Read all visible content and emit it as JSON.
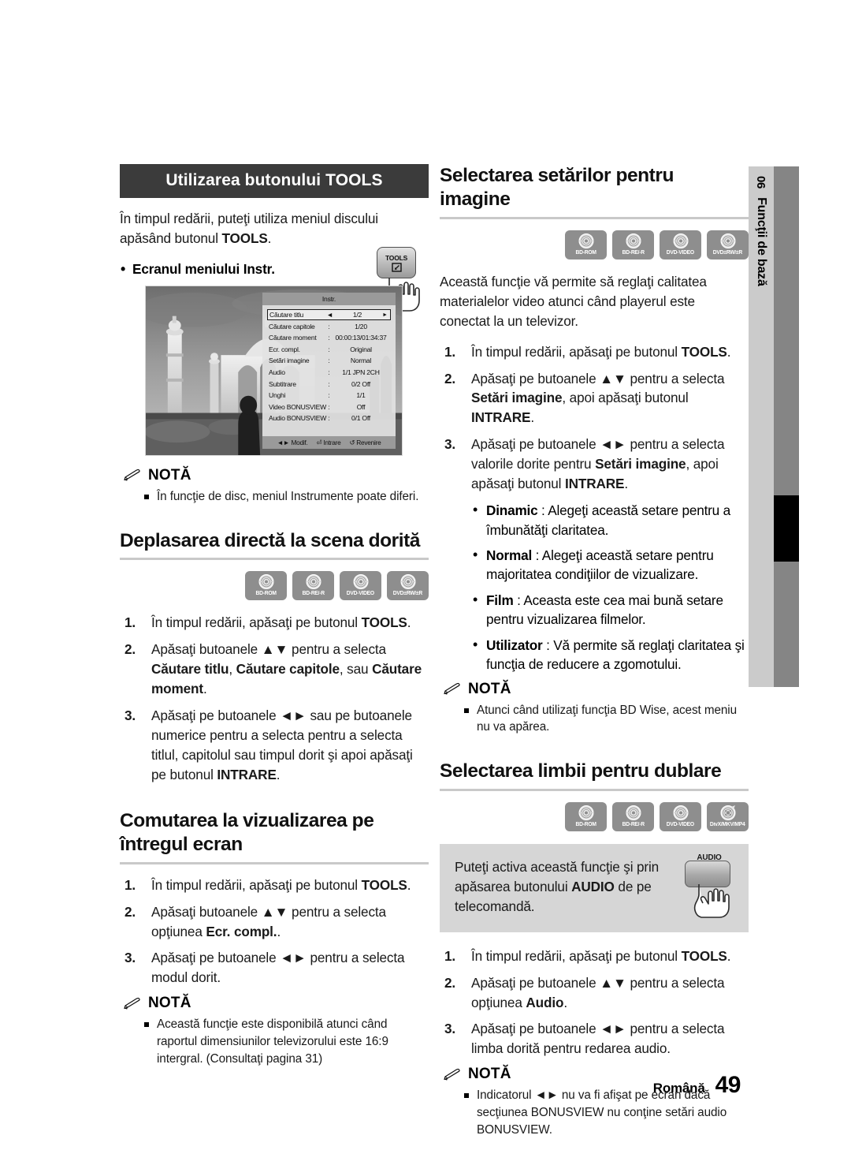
{
  "sidetab": {
    "number": "06",
    "label": "Funcţii de bază"
  },
  "footer": {
    "language": "Română",
    "page": "49"
  },
  "left_column": {
    "tools_header": "Utilizarea butonului TOOLS",
    "intro_before": "În timpul redării, puteţi utiliza meniul discului apăsând butonul ",
    "intro_bold": "TOOLS",
    "intro_after": ".",
    "tools_button_caption": "TOOLS",
    "screen_bullet": "Ecranul meniului Instr.",
    "osd": {
      "title": "Instr.",
      "rows": [
        {
          "key": "Căutare titlu",
          "sep": "",
          "value": "1/2",
          "selected": true
        },
        {
          "key": "Căutare capitole",
          "sep": ":",
          "value": "1/20",
          "selected": false
        },
        {
          "key": "Căutare moment",
          "sep": ":",
          "value": "00:00:13/01:34:37",
          "selected": false
        },
        {
          "key": "Ecr. compl.",
          "sep": ":",
          "value": "Original",
          "selected": false
        },
        {
          "key": "Setări imagine",
          "sep": ":",
          "value": "Normal",
          "selected": false
        },
        {
          "key": "Audio",
          "sep": ":",
          "value": "1/1 JPN 2CH",
          "selected": false
        },
        {
          "key": "Subtitrare",
          "sep": ":",
          "value": "0/2 Off",
          "selected": false
        },
        {
          "key": "Unghi",
          "sep": ":",
          "value": "1/1",
          "selected": false
        },
        {
          "key": "Video BONUSVIEW",
          "sep": ":",
          "value": "Off",
          "selected": false
        },
        {
          "key": "Audio BONUSVIEW",
          "sep": ":",
          "value": "0/1 Off",
          "selected": false
        }
      ],
      "footer": [
        "◄► Modif.",
        "Intrare",
        "Revenire"
      ]
    },
    "nota1": {
      "label": "NOTĂ",
      "items": [
        "În funcţie de disc, meniul Instrumente poate diferi."
      ]
    },
    "section2": {
      "heading": "Deplasarea directă la scena dorită",
      "discs": [
        "BD-ROM",
        "BD-RE/-R",
        "DVD-VIDEO",
        "DVD±RW/±R"
      ],
      "steps": [
        {
          "num": "1.",
          "html": "În timpul redării, apăsaţi pe butonul <b>TOOLS</b>."
        },
        {
          "num": "2.",
          "html": "Apăsaţi butoanele ▲▼ pentru a selecta <b>Căutare titlu</b>, <b>Căutare capitole</b>, sau <b>Căutare moment</b>."
        },
        {
          "num": "3.",
          "html": "Apăsaţi pe butoanele ◄► sau pe butoanele numerice pentru a selecta pentru a selecta titlul, capitolul sau timpul dorit şi apoi apăsaţi pe butonul <b>INTRARE</b>."
        }
      ]
    },
    "section3": {
      "heading": "Comutarea la vizualizarea pe întregul ecran",
      "steps": [
        {
          "num": "1.",
          "html": "În timpul redării, apăsaţi pe butonul <b>TOOLS</b>."
        },
        {
          "num": "2.",
          "html": "Apăsaţi butoanele ▲▼ pentru a selecta opţiunea <b>Ecr. compl.</b>."
        },
        {
          "num": "3.",
          "html": "Apăsaţi pe butoanele ◄► pentru a selecta modul dorit."
        }
      ],
      "nota": {
        "label": "NOTĂ",
        "items": [
          "Această funcţie este disponibilă atunci când raportul dimensiunilor televizorului este 16:9 intergral. (Consultaţi pagina 31)"
        ]
      }
    }
  },
  "right_column": {
    "section1": {
      "heading": "Selectarea setărilor pentru imagine",
      "discs": [
        "BD-ROM",
        "BD-RE/-R",
        "DVD-VIDEO",
        "DVD±RW/±R"
      ],
      "intro": "Această funcţie vă permite să reglaţi calitatea materialelor video atunci când playerul este conectat la un televizor.",
      "steps": [
        {
          "num": "1.",
          "html": "În timpul redării, apăsaţi pe butonul <b>TOOLS</b>."
        },
        {
          "num": "2.",
          "html": "Apăsaţi pe butoanele ▲▼ pentru a selecta <b>Setări imagine</b>, apoi apăsaţi butonul <b>INTRARE</b>."
        },
        {
          "num": "3.",
          "html": "Apăsaţi pe butoanele ◄► pentru a selecta valorile dorite pentru <b>Setări imagine</b>, apoi apăsaţi butonul <b>INTRARE</b>."
        }
      ],
      "options": [
        {
          "name": "Dinamic",
          "desc": " : Alegeţi această setare pentru a îmbunătăţi claritatea."
        },
        {
          "name": "Normal",
          "desc": " : Alegeţi această setare pentru majoritatea condiţiilor de vizualizare."
        },
        {
          "name": "Film",
          "desc": " : Aceasta este cea mai bună setare pentru vizualizarea filmelor."
        },
        {
          "name": "Utilizator",
          "desc": " : Vă permite să reglaţi claritatea şi funcţia de reducere a zgomotului."
        }
      ],
      "nota": {
        "label": "NOTĂ",
        "items": [
          "Atunci când utilizaţi funcţia BD Wise, acest meniu nu va apărea."
        ]
      }
    },
    "section2": {
      "heading": "Selectarea limbii pentru dublare",
      "discs": [
        "BD-ROM",
        "BD-RE/-R",
        "DVD-VIDEO",
        "DivX/MKV/MP4"
      ],
      "tip_html": "Puteţi activa această funcţie şi prin apăsarea butonului <b>AUDIO</b> de pe telecomandă.",
      "tip_button_caption": "AUDIO",
      "steps": [
        {
          "num": "1.",
          "html": "În timpul redării, apăsaţi pe butonul <b>TOOLS</b>."
        },
        {
          "num": "2.",
          "html": "Apăsaţi pe butoanele ▲▼ pentru a selecta opţiunea <b>Audio</b>."
        },
        {
          "num": "3.",
          "html": "Apăsaţi pe butoanele ◄► pentru a selecta limba dorită pentru redarea audio."
        }
      ],
      "nota": {
        "label": "NOTĂ",
        "items": [
          "Indicatorul ◄► nu va fi afişat pe ecran dacă secţiunea BONUSVIEW nu conţine setări audio BONUSVIEW."
        ]
      }
    }
  }
}
